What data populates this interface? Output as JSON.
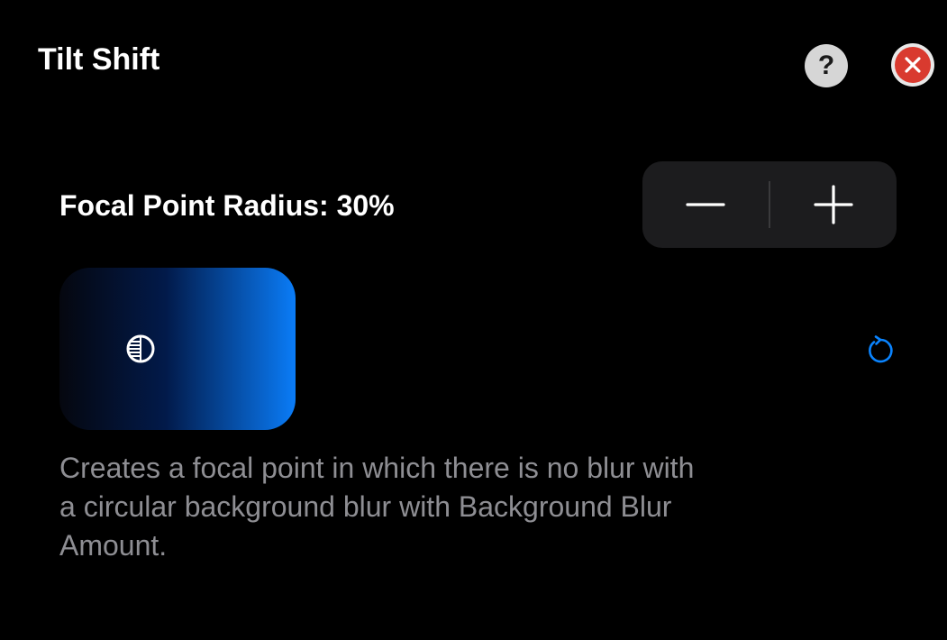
{
  "header": {
    "title": "Tilt Shift",
    "help_label": "?"
  },
  "setting": {
    "label": "Focal Point Radius: 30%"
  },
  "preview": {
    "gradient_start": "#05070f",
    "gradient_end": "#0a7cf7",
    "icon": "focal-point-icon"
  },
  "description": "Creates a focal point in which there is no blur with a circular background blur with Background Blur Amount.",
  "colors": {
    "background": "#000000",
    "accent": "#0a84ff",
    "close_red": "#d93a2f",
    "stepper_bg": "#1c1c1e",
    "secondary_text": "#8e8e93"
  },
  "icons": {
    "help": "question-icon",
    "close": "close-icon",
    "decrement": "minus-icon",
    "increment": "plus-icon",
    "reset": "reset-icon"
  }
}
